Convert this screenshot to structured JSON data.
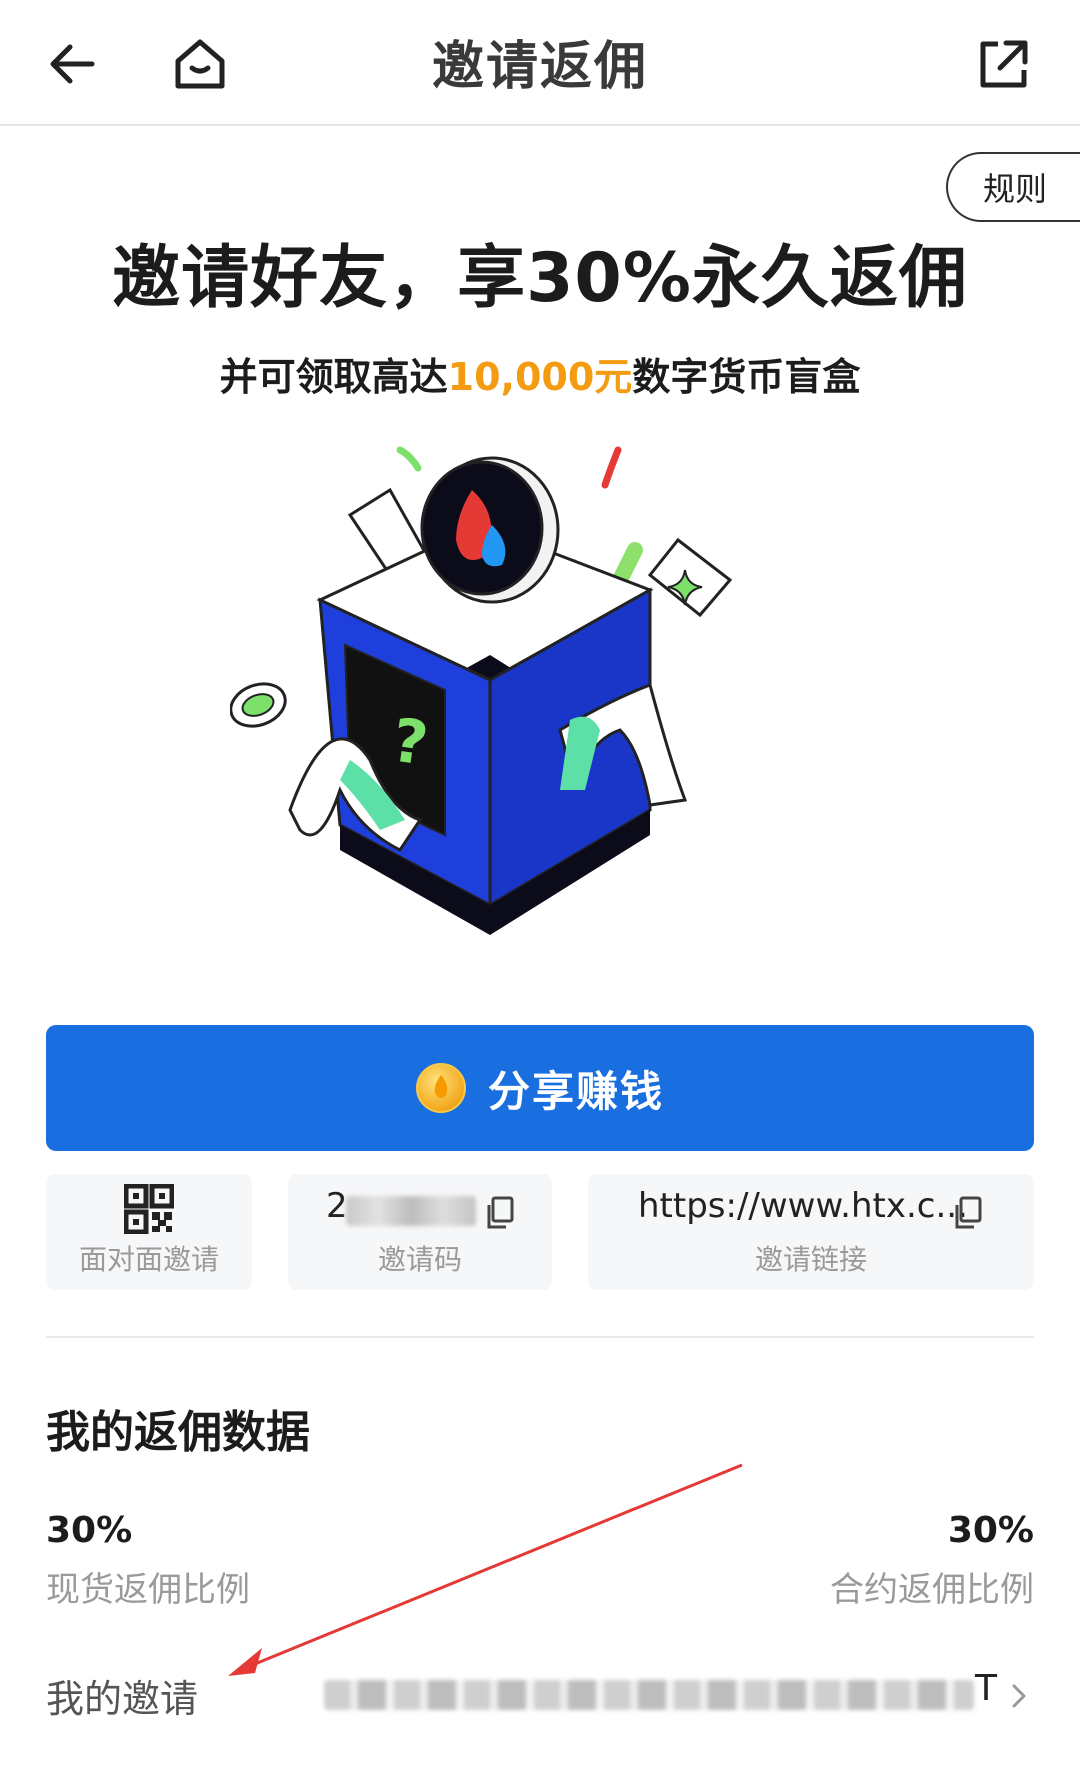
{
  "header": {
    "title": "邀请返佣"
  },
  "rules_label": "规则",
  "headline": "邀请好友，享30%永久返佣",
  "subline": {
    "before": "并可领取高达",
    "highlight": "10,000元",
    "after": "数字货币盲盒"
  },
  "share_button": {
    "label": "分享赚钱"
  },
  "tiles": {
    "face_to_face": {
      "label": "面对面邀请"
    },
    "invite_code": {
      "value_prefix": "2",
      "label": "邀请码"
    },
    "invite_link": {
      "value": "https://www.htx.c...",
      "label": "邀请链接"
    }
  },
  "section": {
    "title": "我的返佣数据"
  },
  "stats": {
    "spot": {
      "value": "30%",
      "label": "现货返佣比例"
    },
    "futures": {
      "value": "30%",
      "label": "合约返佣比例"
    }
  },
  "my_invites": {
    "label": "我的邀请",
    "value_suffix": "T"
  },
  "colors": {
    "primary": "#1a6fe0",
    "highlight": "#f39c12",
    "annotation_arrow": "#e53935"
  },
  "icons": [
    "back-arrow-icon",
    "home-icon",
    "external-share-icon",
    "coin-icon",
    "qr-code-icon",
    "copy-icon",
    "chevron-right-icon"
  ]
}
